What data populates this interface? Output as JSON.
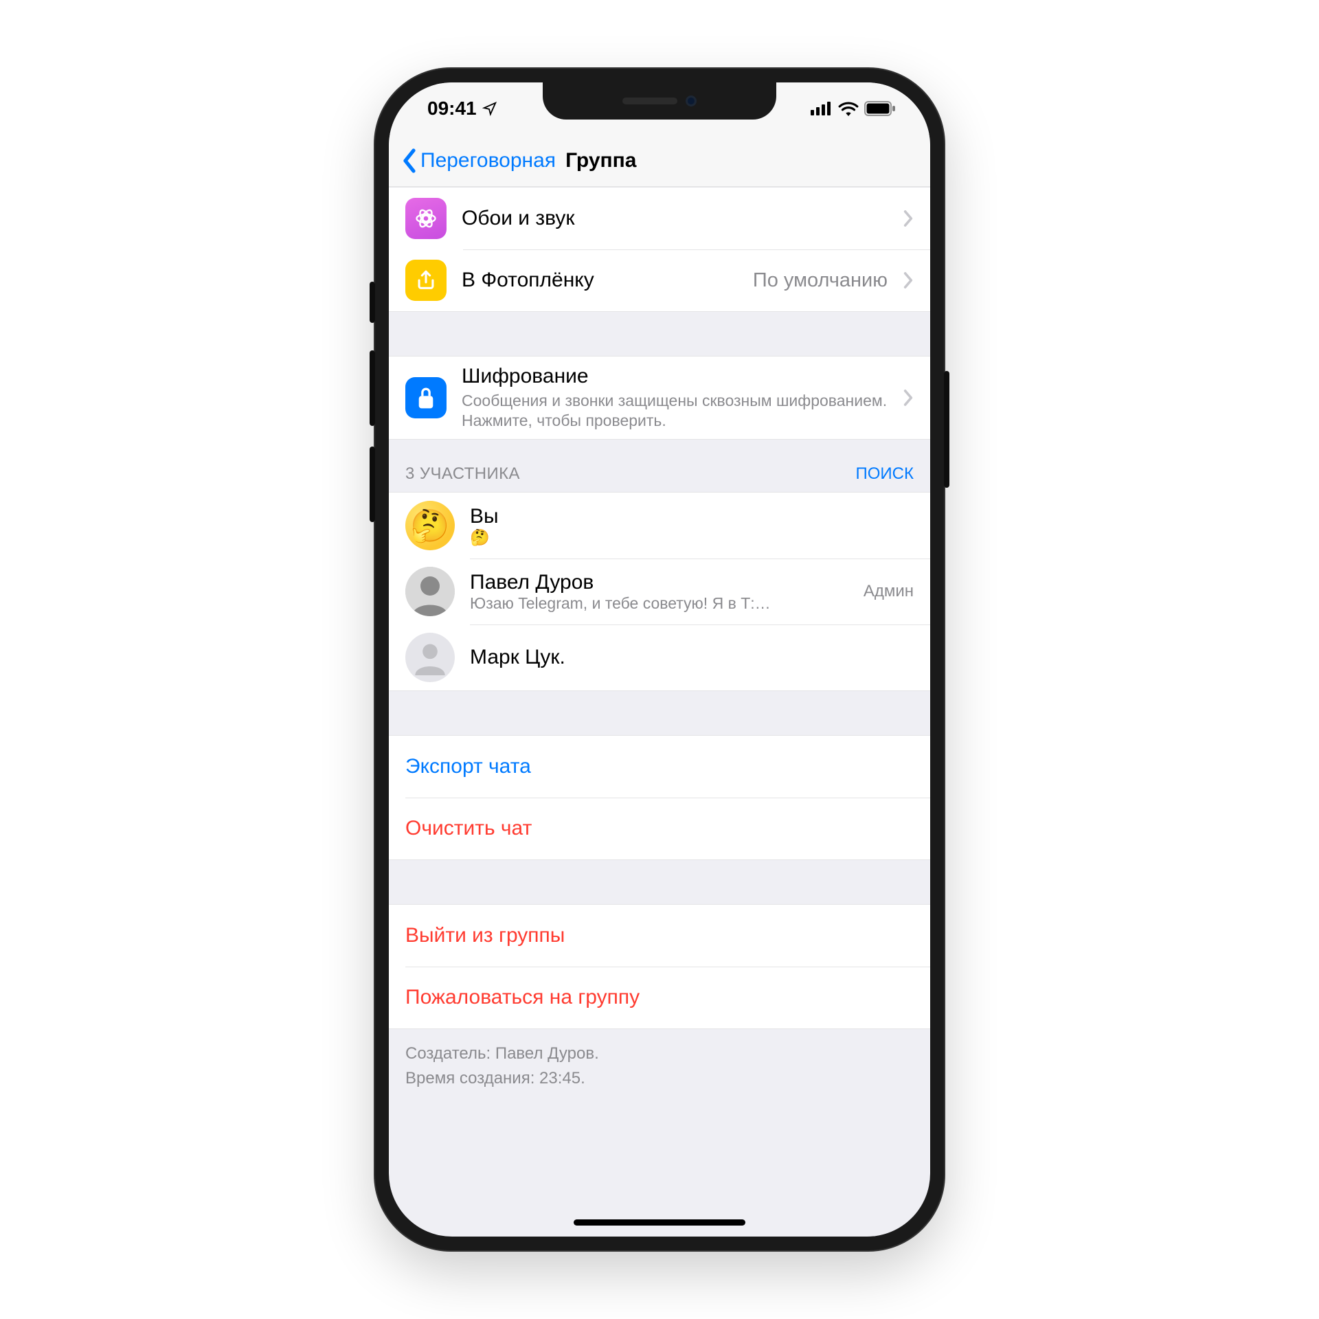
{
  "status": {
    "time": "09:41"
  },
  "nav": {
    "back_label": "Переговорная",
    "title": "Группа"
  },
  "settings_group1": {
    "wallpaper": {
      "title": "Обои и звук"
    },
    "photo_roll": {
      "title": "В Фотоплёнку",
      "value": "По умолчанию"
    }
  },
  "settings_group2": {
    "encryption": {
      "title": "Шифрование",
      "subtitle": "Сообщения и звонки защищены сквозным шифрованием. Нажмите, чтобы проверить."
    }
  },
  "members_section": {
    "header": "3 УЧАСТНИКА",
    "search": "ПОИСК",
    "items": [
      {
        "name": "Вы",
        "sub": "🤔",
        "role": "",
        "avatar": "emoji"
      },
      {
        "name": "Павел Дуров",
        "sub": "Юзаю Telegram, и тебе советую! Я в Т:…",
        "role": "Админ",
        "avatar": "bw"
      },
      {
        "name": "Марк Цук.",
        "sub": "",
        "role": "",
        "avatar": "empty"
      }
    ]
  },
  "actions1": {
    "export": {
      "label": "Экспорт чата",
      "color": "#007aff"
    },
    "clear": {
      "label": "Очистить чат",
      "color": "#ff3b30"
    }
  },
  "actions2": {
    "leave": {
      "label": "Выйти из группы",
      "color": "#ff3b30"
    },
    "report": {
      "label": "Пожаловаться на группу",
      "color": "#ff3b30"
    }
  },
  "footer": {
    "line1": "Создатель: Павел Дуров.",
    "line2": "Время создания: 23:45."
  },
  "colors": {
    "icon_wallpaper": "#d85ce6",
    "icon_photoroll": "#ffcc00",
    "icon_encryption": "#007aff"
  }
}
